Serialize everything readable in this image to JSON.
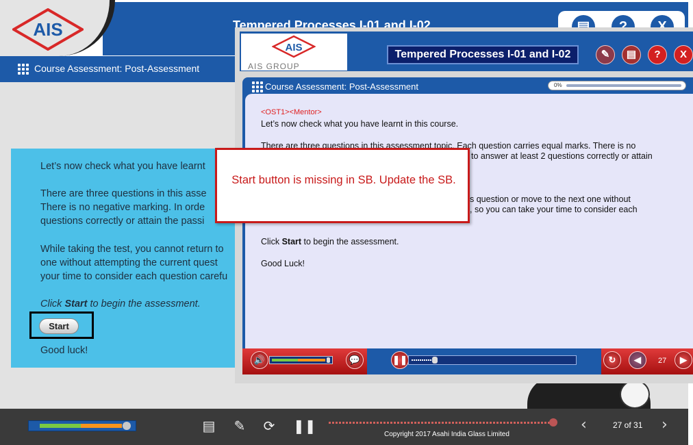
{
  "course_player": {
    "logo_text": "AIS",
    "title": "Tempered Processes I-01 and I-02",
    "top_buttons": [
      {
        "icon": "notes-icon",
        "glyph": "▤"
      },
      {
        "icon": "help-icon",
        "glyph": "?"
      },
      {
        "icon": "close-icon",
        "glyph": "X"
      }
    ],
    "section_title": "Course Assessment: Post-Assessment",
    "body": {
      "intro": "Let’s now check what you have learnt",
      "para1_line1": "There are three questions in this asse",
      "para1_line2": "There is no negative marking. In orde",
      "para1_line3": "questions correctly or attain the passi",
      "para2_line1": "While taking the test, you cannot return to",
      "para2_line2": "one without attempting the current quest",
      "para2_line3": "your time to consider each question carefu",
      "click_prefix": "Click ",
      "click_bold": "Start",
      "click_suffix": " to begin the assessment.",
      "start_label": "Start",
      "good_luck": "Good luck!"
    },
    "footer": {
      "copyright": "Copyright 2017 Asahi India Glass Limited",
      "page": "27 of 31",
      "progress_fraction": 0.87
    }
  },
  "storyboard_window": {
    "logo_text": "AIS",
    "group_label": "AIS GROUP",
    "title": "Tempered Processes  I-01 and I-02",
    "toolbar_icons": [
      {
        "icon": "edit-icon",
        "glyph": "✎",
        "color": "#c23232"
      },
      {
        "icon": "print-icon",
        "glyph": "▤",
        "color": "#c23232"
      },
      {
        "icon": "help-icon",
        "glyph": "?",
        "color": "#d32020"
      },
      {
        "icon": "close-icon",
        "glyph": "X",
        "color": "#d32020"
      }
    ],
    "section_title": "Course Assessment: Post-Assessment",
    "progress_label": "0%",
    "content": {
      "tag": "<OST1><Mentor>",
      "line1": "Let’s now check what you have learnt in this course.",
      "line2": "There are three questions in this assessment topic. Each question carries equal marks. There is no",
      "line3": "to answer at least 2 questions correctly or attain",
      "line4": "s question or move to the next one without",
      "line5": ", so you can take your time to consider each",
      "click_prefix": "Click ",
      "click_bold": "Start",
      "click_suffix": " to begin the assessment.",
      "good_luck": "Good Luck!"
    },
    "page_number": "27"
  },
  "review_note": {
    "text": "Start button is missing in SB. Update the SB.",
    "color": "#c81a1a"
  },
  "colors": {
    "brand_blue": "#1d5aa8",
    "panel_cyan": "#4cc0e8",
    "accent_red": "#d32020"
  }
}
